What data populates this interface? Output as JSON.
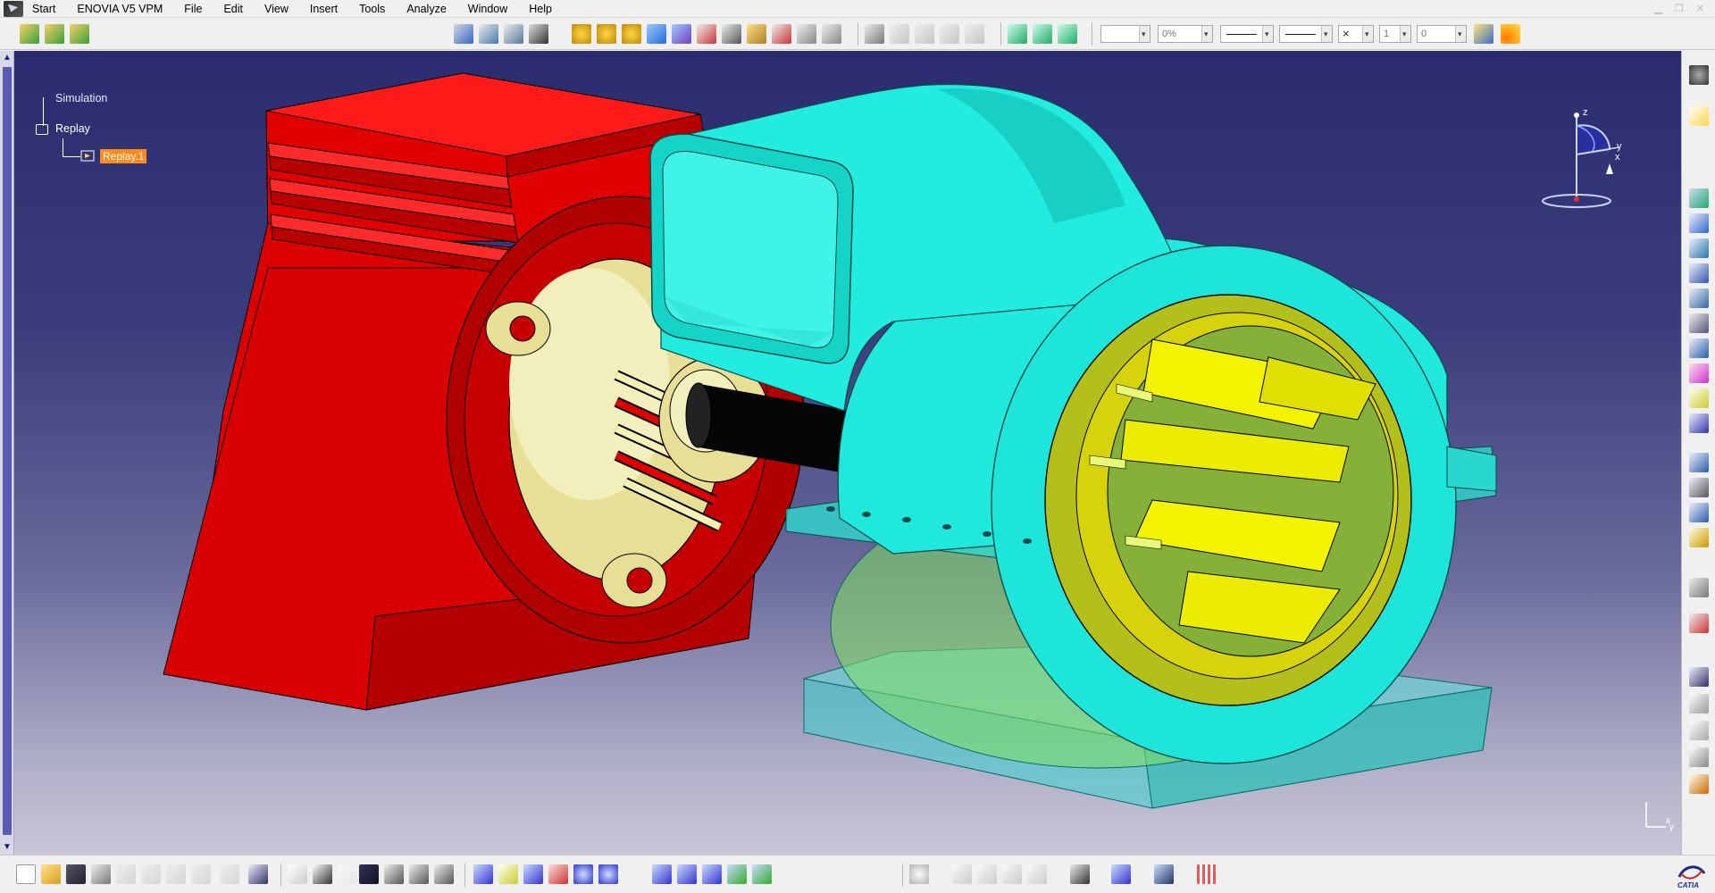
{
  "menu": {
    "start": "Start",
    "app_name": "ENOVIA V5 VPM",
    "items": [
      "File",
      "Edit",
      "View",
      "Insert",
      "Tools",
      "Analyze",
      "Window",
      "Help"
    ]
  },
  "toolbar": {
    "thickness_value": "0%",
    "layer_value": "0",
    "width_value": "1",
    "cross_symbol": "×"
  },
  "tree": {
    "simulation_label": "Simulation",
    "replay_label": "Replay",
    "selected_label": "Replay.1"
  },
  "compass": {
    "x_label": "x",
    "y_label": "y",
    "z_label": "z"
  },
  "corner_axis": {
    "x_label": "x",
    "y_label": "y"
  },
  "brand": {
    "logo_text": "CATIA"
  },
  "colors": {
    "motor_body": "#e00000",
    "motor_dark": "#a80000",
    "end_cap": "#e8e29a",
    "housing": "#19e4d8",
    "housing_dark": "#0fb5ac",
    "impeller": "#f0f000",
    "shaft": "#050505",
    "selection_highlight": "#ff8a1e",
    "viewport_top": "#2b2c6f",
    "viewport_bottom": "#c7c6d8"
  },
  "icons": {
    "top": [
      "open-product-icon",
      "insert-product-icon",
      "replace-icon",
      "clash-icon",
      "sectioning-icon",
      "distance-icon",
      "simulation-icon",
      "track-icon",
      "sequence-icon",
      "replay-icon",
      "compile-icon",
      "movie-icon",
      "edit-icon",
      "player-icon",
      "measure-icon",
      "catalog-icon",
      "layer-icon",
      "paint-icon",
      "magic-wand-icon"
    ],
    "right": [
      "compass-icon",
      "select-icon",
      "group-icon",
      "shuttle-icon",
      "track-tool-icon",
      "sequence-tool-icon",
      "interference-icon",
      "clash-tool-icon",
      "band-analysis-icon",
      "swept-volume-icon",
      "trace-icon",
      "smooth-icon",
      "video-icon",
      "annotation-icon",
      "text-icon",
      "3d-text-icon",
      "weld-icon",
      "flag-icon"
    ],
    "bottom": [
      "new-file-icon",
      "open-file-icon",
      "save-icon",
      "print-icon",
      "cut-icon",
      "copy-icon",
      "paste-icon",
      "undo-icon",
      "redo-icon",
      "whats-this-icon",
      "formula-icon",
      "knowledge-icon",
      "light-icon",
      "table-icon",
      "tree-icon",
      "lock-icon",
      "graph-icon",
      "fly-icon",
      "fit-all-icon",
      "pan-icon",
      "rotate-icon",
      "zoom-in-icon",
      "zoom-out-icon",
      "normal-view-icon",
      "iso-view-icon",
      "shading-icon",
      "hide-show-icon",
      "swap-visible-icon",
      "refresh-icon",
      "measure-between-icon",
      "measure-item-icon",
      "camera-icon",
      "reframe-icon",
      "eraser-icon",
      "grid-icon"
    ]
  }
}
